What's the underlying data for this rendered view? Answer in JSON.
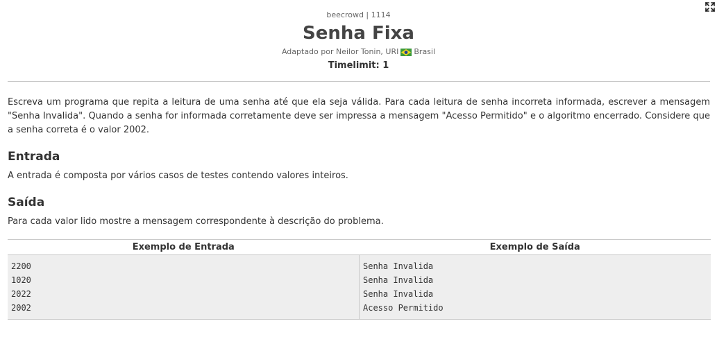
{
  "header": {
    "breadcrumb": "beecrowd | 1114",
    "title": "Senha Fixa",
    "author": "Adaptado por Neilor Tonin, URI",
    "country": "Brasil",
    "timelimit": "Timelimit: 1"
  },
  "problem": {
    "description": "Escreva um programa que repita a leitura de uma senha até que ela seja válida. Para cada leitura de senha incorreta informada, escrever a mensagem \"Senha Invalida\". Quando a senha for informada corretamente deve ser impressa a mensagem \"Acesso Permitido\" e o algoritmo encerrado. Considere que a senha correta é o valor 2002."
  },
  "input_section": {
    "heading": "Entrada",
    "text": "A entrada é composta por vários casos de testes contendo valores inteiros."
  },
  "output_section": {
    "heading": "Saída",
    "text": "Para cada valor lido mostre a mensagem correspondente à descrição do problema."
  },
  "examples": {
    "input_header": "Exemplo de Entrada",
    "output_header": "Exemplo de Saída",
    "input_lines": [
      "2200",
      "1020",
      "2022",
      "2002"
    ],
    "output_lines": [
      "Senha Invalida",
      "Senha Invalida",
      "Senha Invalida",
      "Acesso Permitido"
    ]
  },
  "icons": {
    "expand": "expand-icon",
    "flag": "brazil-flag-icon"
  },
  "colors": {
    "flag_green": "#3c9a3c",
    "flag_yellow": "#f4d81e",
    "flag_blue": "#1f3f9a"
  }
}
